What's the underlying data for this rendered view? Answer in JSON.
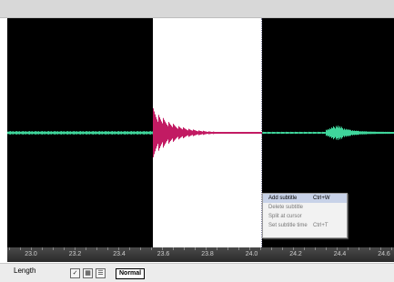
{
  "ruler": {
    "ticks": [
      "23.0",
      "23.2",
      "23.4",
      "23.6",
      "23.8",
      "24.0",
      "24.2",
      "24.4",
      "24.6"
    ]
  },
  "context_menu": {
    "items": [
      {
        "label": "Add subtitle",
        "shortcut": "Ctrl+W",
        "active": true
      },
      {
        "label": "Delete subtitle",
        "shortcut": "",
        "active": false
      },
      {
        "label": "Split at cursor",
        "shortcut": "",
        "active": false
      },
      {
        "label": "Set subtitle time",
        "shortcut": "Ctrl+T",
        "active": false
      }
    ]
  },
  "bottom_bar": {
    "length_label": "Length",
    "mode_label": "Normal"
  },
  "colors": {
    "canvas_bg": "#000000",
    "selection_bg": "#ffffff",
    "wave_unselected": "#3fd59b",
    "wave_selected": "#c21b63"
  }
}
